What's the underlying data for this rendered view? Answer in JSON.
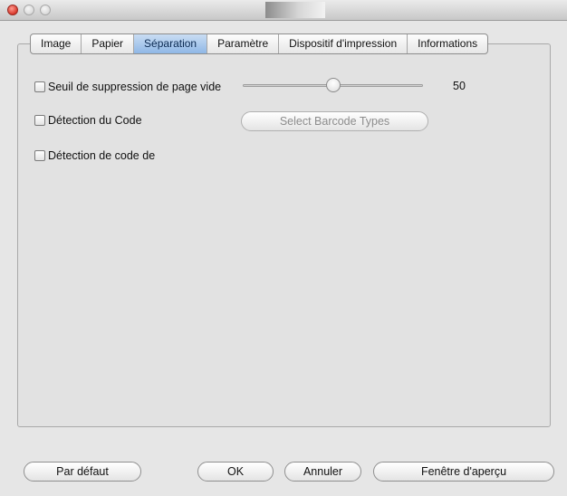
{
  "tabs": [
    {
      "label": "Image"
    },
    {
      "label": "Papier"
    },
    {
      "label": "Séparation",
      "selected": true
    },
    {
      "label": "Paramètre"
    },
    {
      "label": "Dispositif d'impression"
    },
    {
      "label": "Informations"
    }
  ],
  "separation": {
    "blank_page": {
      "label": "Seuil de suppression de page vide",
      "checked": false,
      "slider_value": "50"
    },
    "barcode": {
      "label": "Détection du Code",
      "checked": false,
      "button_label": "Select Barcode Types"
    },
    "patch_code": {
      "label": "Détection de code de",
      "checked": false
    }
  },
  "footer": {
    "default_label": "Par défaut",
    "ok_label": "OK",
    "cancel_label": "Annuler",
    "preview_label": "Fenêtre d'aperçu"
  },
  "colors": {
    "selected_tab": "#9dbfe8",
    "window_bg": "#e6e6e6"
  }
}
